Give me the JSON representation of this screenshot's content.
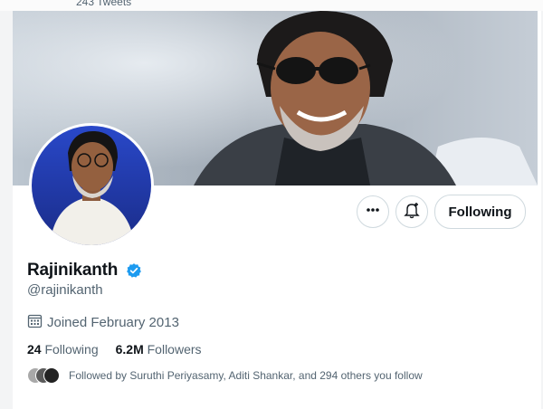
{
  "header": {
    "tweet_count": "243 Tweets"
  },
  "profile": {
    "name": "Rajinikanth",
    "handle": "@rajinikanth",
    "joined": "Joined February 2013",
    "following_count": "24",
    "following_label": "Following",
    "followers_count": "6.2M",
    "followers_label": "Followers",
    "followed_by": "Followed by Suruthi Periyasamy, Aditi Shankar, and 294 others you follow"
  },
  "actions": {
    "follow_button": "Following",
    "more_icon": "more-icon",
    "notify_icon": "bell-plus-icon"
  },
  "colors": {
    "verified": "#1d9bf0",
    "text_secondary": "#536471",
    "border": "#cfd9de"
  }
}
